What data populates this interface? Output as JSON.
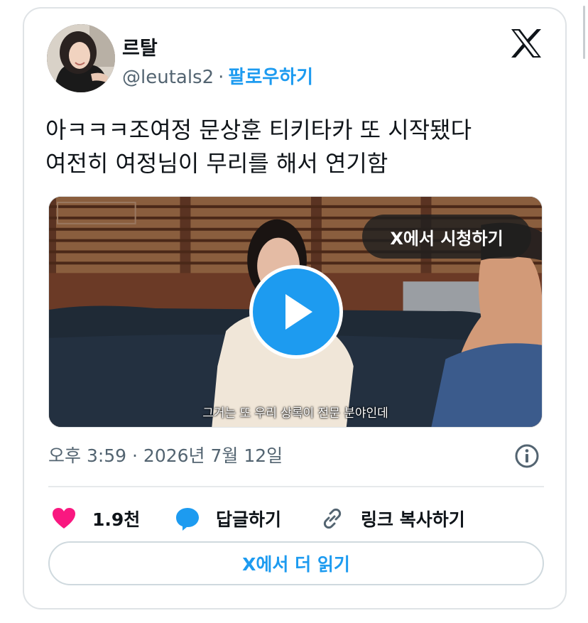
{
  "author": {
    "display_name": "르탈",
    "handle": "@leutals2",
    "separator": "·",
    "follow_label": "팔로우하기"
  },
  "tweet": {
    "text_line1": "아ㅋㅋㅋ조여정 문상훈 티키타카 또 시작됐다",
    "text_line2": "여전히 여정님이 무리를 해서 연기함"
  },
  "video": {
    "watch_label": "X에서 시청하기",
    "subtitle": "그거는 또 우리 상록이 전문 분야인데"
  },
  "timestamp": "오후 3:59 · 2026년 7월 12일",
  "actions": {
    "like_count": "1.9천",
    "reply_label": "답글하기",
    "copy_link_label": "링크 복사하기"
  },
  "read_more_label": "X에서 더 읽기",
  "colors": {
    "accent": "#1d9bf0",
    "like": "#f91880",
    "text": "#0f1419",
    "muted": "#536471"
  },
  "icons": [
    "x-logo-icon",
    "info-icon",
    "heart-icon",
    "speech-bubble-icon",
    "link-icon",
    "play-icon"
  ]
}
